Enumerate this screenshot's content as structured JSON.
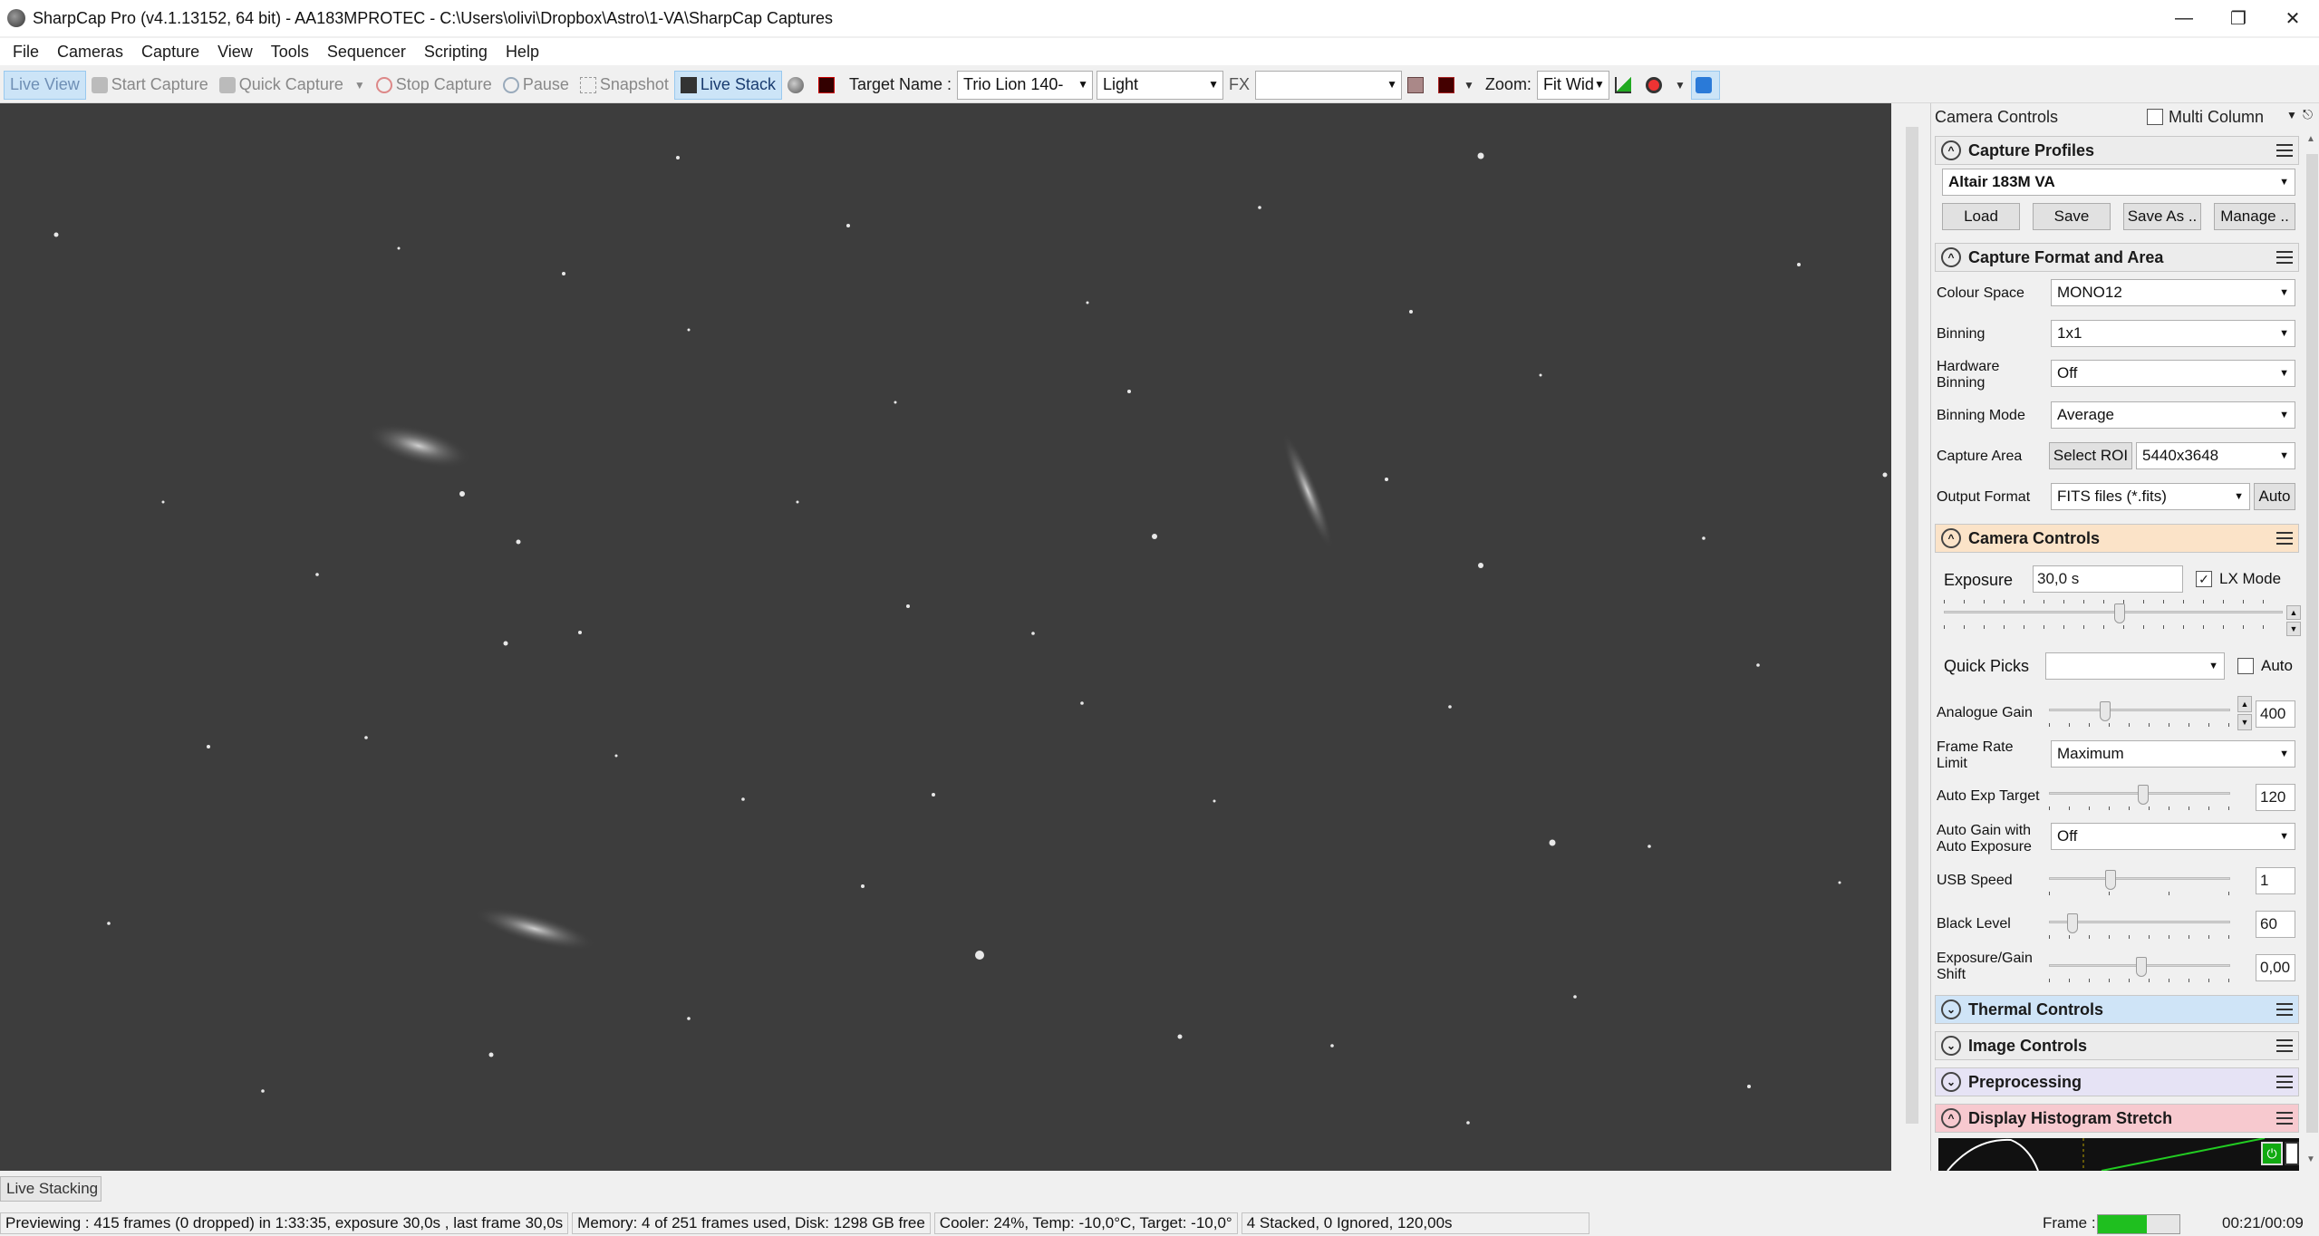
{
  "window": {
    "title": "SharpCap Pro (v4.1.13152, 64 bit) - AA183MPROTEC - C:\\Users\\olivi\\Dropbox\\Astro\\1-VA\\SharpCap Captures"
  },
  "menu": [
    "File",
    "Cameras",
    "Capture",
    "View",
    "Tools",
    "Sequencer",
    "Scripting",
    "Help"
  ],
  "toolbar": {
    "live_view": "Live View",
    "start_capture": "Start Capture",
    "quick_capture": "Quick Capture",
    "stop_capture": "Stop Capture",
    "pause": "Pause",
    "snapshot": "Snapshot",
    "live_stack": "Live Stack",
    "target_name_label": "Target Name :",
    "target_name_value": "Trio Lion 140-",
    "frame_type": "Light",
    "fx_label": "FX",
    "fx_value": "",
    "zoom_label": "Zoom:",
    "zoom_value": "Fit Wid"
  },
  "panel": {
    "title": "Camera Controls",
    "multi_column": "Multi Column",
    "capture_profiles": {
      "header": "Capture Profiles",
      "profile": "Altair 183M VA",
      "load": "Load",
      "save": "Save",
      "save_as": "Save As ..",
      "manage": "Manage .."
    },
    "format_area": {
      "header": "Capture Format and Area",
      "colour_space_label": "Colour Space",
      "colour_space": "MONO12",
      "binning_label": "Binning",
      "binning": "1x1",
      "hw_binning_label1": "Hardware",
      "hw_binning_label2": "Binning",
      "hw_binning": "Off",
      "binning_mode_label": "Binning Mode",
      "binning_mode": "Average",
      "capture_area_label": "Capture Area",
      "select_roi": "Select ROI",
      "capture_area": "5440x3648",
      "output_format_label": "Output Format",
      "output_format": "FITS files (*.fits)",
      "auto": "Auto"
    },
    "camera_controls": {
      "header": "Camera Controls",
      "exposure_label": "Exposure",
      "exposure": "30,0 s",
      "lx_mode": "LX Mode",
      "quick_picks_label": "Quick Picks",
      "quick_picks": "",
      "auto_label": "Auto",
      "analogue_gain_label": "Analogue Gain",
      "analogue_gain": "400",
      "frame_rate_label1": "Frame Rate",
      "frame_rate_label2": "Limit",
      "frame_rate": "Maximum",
      "auto_exp_target_label": "Auto Exp Target",
      "auto_exp_target": "120",
      "auto_gain_label1": "Auto Gain with",
      "auto_gain_label2": "Auto Exposure",
      "auto_gain": "Off",
      "usb_speed_label": "USB Speed",
      "usb_speed": "1",
      "black_level_label": "Black Level",
      "black_level": "60",
      "exp_gain_shift_label1": "Exposure/Gain",
      "exp_gain_shift_label2": "Shift",
      "exp_gain_shift": "0,00"
    },
    "thermal_controls": "Thermal Controls",
    "image_controls": "Image Controls",
    "preprocessing": "Preprocessing",
    "display_histogram": "Display Histogram Stretch"
  },
  "status": {
    "live_stacking_tab": "Live Stacking",
    "preview": "Previewing : 415 frames (0 dropped) in 1:33:35, exposure 30,0s , last frame 30,0s",
    "memory": "Memory: 4 of 251 frames used, Disk: 1298 GB free",
    "cooler": "Cooler: 24%, Temp: -10,0°C, Target: -10,0°",
    "stacked": "4 Stacked, 0 Ignored, 120,00s",
    "frame_label": "Frame :",
    "frame_progress": 0.6,
    "frame_time": "00:21/00:09"
  },
  "colors": {
    "thermal_header": "#cfe4f7",
    "image_header": "#ececec",
    "preprocessing_header": "#e6e3f5",
    "histogram_header": "#f7c9cf",
    "camera_header": "#fbe3c8",
    "frame_bar": "#1fbf1f"
  }
}
